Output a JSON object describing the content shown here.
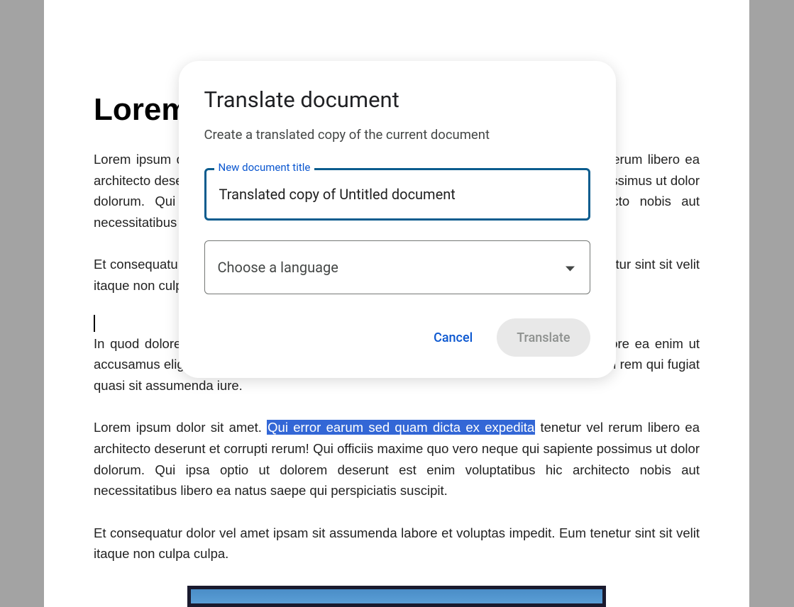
{
  "document": {
    "heading": "Lorem Ipsum",
    "paragraph1": "Lorem ipsum dolor sit amet. Qui error earum sed quam dicta ex expedita tenetur vel rerum libero ea architecto deserunt et corrupti rerum! Qui officiis maxime quo vero neque qui sapiente possimus ut dolor dolorum. Qui ipsa optio ut dolorem deserunt est enim voluptatibus hic architecto nobis aut necessitatibus libero ea natus saepe qui perspiciatis suscipit.",
    "paragraph2": "Et consequatur dolor vel amet ipsam sit assumenda labore et voluptas impedit. Eum tenetur sint sit velit itaque non culpa culpa.",
    "paragraph3": "In quod dolore ut autem dolore aut eveniet autem. Vel laborum repellat aut nihil tempore ea enim ut accusamus eligendi. Eum animi iure et molestiae reiciendis non quia optio in accusantium rem qui fugiat quasi sit assumenda iure.",
    "paragraph4_pre": "Lorem ipsum dolor sit amet. ",
    "paragraph4_highlight": "Qui error earum sed quam dicta ex expedita",
    "paragraph4_post": " tenetur vel rerum libero ea architecto deserunt et corrupti rerum! Qui officiis maxime quo vero neque qui sapiente possimus ut dolor dolorum. Qui ipsa optio ut dolorem deserunt est enim voluptatibus hic architecto nobis aut necessitatibus libero ea natus saepe qui perspiciatis suscipit.",
    "paragraph5": "Et consequatur dolor vel amet ipsam sit assumenda labore et voluptas impedit. Eum tenetur sint sit velit itaque non culpa culpa."
  },
  "dialog": {
    "title": "Translate document",
    "subtitle": "Create a translated copy of the current document",
    "input_label": "New document title",
    "input_value": "Translated copy of Untitled document",
    "language_placeholder": "Choose a language",
    "cancel_label": "Cancel",
    "translate_label": "Translate"
  }
}
